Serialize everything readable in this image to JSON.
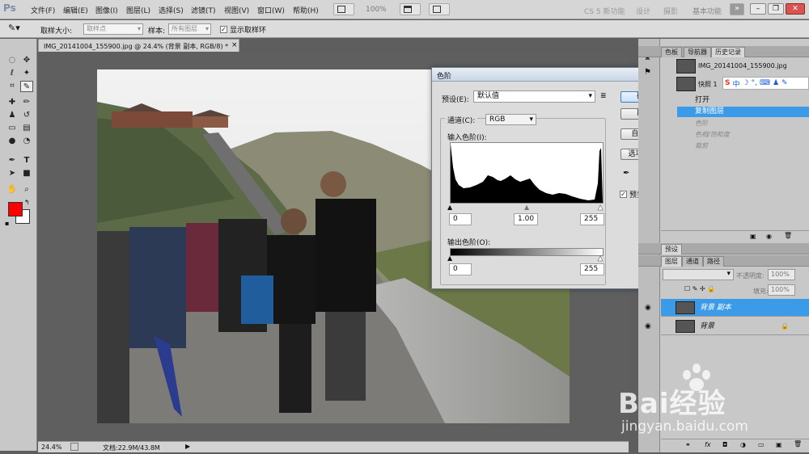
{
  "app": {
    "logo": "Ps",
    "menus": [
      "文件(F)",
      "编辑(E)",
      "图像(I)",
      "图层(L)",
      "选择(S)",
      "滤镜(T)",
      "视图(V)",
      "窗口(W)",
      "帮助(H)"
    ],
    "zoom_display": "100%",
    "workspaces": [
      "CS 5 新功能",
      "设计",
      "摄影",
      "基本功能"
    ],
    "more": "»"
  },
  "options_bar": {
    "sample_size_label": "取样大小:",
    "sample_size_value": "取样点",
    "sample_label": "样本:",
    "sample_value": "所有图层",
    "show_ring_label": "显示取样环"
  },
  "document": {
    "tab_title": "IMG_20141004_155900.jpg @ 24.4% (背景 副本, RGB/8) *",
    "close": "×",
    "status_zoom": "24.4%",
    "status_doc": "文档:22.9M/43.8M"
  },
  "levels": {
    "title": "色阶",
    "preset_label": "预设(E):",
    "preset_value": "默认值",
    "channel_label": "通道(C):",
    "channel_value": "RGB",
    "input_label": "输入色阶(I):",
    "input_black": "0",
    "input_gamma": "1.00",
    "input_white": "255",
    "output_label": "输出色阶(O):",
    "output_black": "0",
    "output_white": "255",
    "buttons": {
      "ok": "确定",
      "cancel": "取消",
      "auto": "自动(A)",
      "options": "选项(T)..."
    },
    "preview_label": "预览(P)",
    "preview_checked": true
  },
  "panels": {
    "top_tabs": [
      "色板",
      "导航器",
      "历史记录"
    ],
    "history_snapshot": "IMG_20141004_155900.jpg",
    "history_snapshot2": "快照 1",
    "history_items": [
      {
        "label": "打开",
        "state": "normal"
      },
      {
        "label": "复制图层",
        "state": "selected"
      },
      {
        "label": "色阶",
        "state": "dimmed"
      },
      {
        "label": "色相/饱和度",
        "state": "dimmed"
      },
      {
        "label": "裁剪",
        "state": "dimmed"
      }
    ],
    "layers_tabs": [
      "图层",
      "通道",
      "路径"
    ],
    "layers_header": "预设",
    "opacity_label": "不透明度:",
    "opacity_value": "100%",
    "fill_label": "填充:",
    "fill_value": "100%",
    "layers": [
      {
        "name": "背景 副本",
        "selected": true
      },
      {
        "name": "背景",
        "selected": false
      }
    ]
  },
  "ime_toolbar": {
    "label": "中"
  },
  "watermark": {
    "brand": "Bai经验",
    "url": "jingyan.baidu.com"
  },
  "colors": {
    "accent": "#3b9be8",
    "foreground": "#ff0000",
    "background": "#ffffff"
  }
}
